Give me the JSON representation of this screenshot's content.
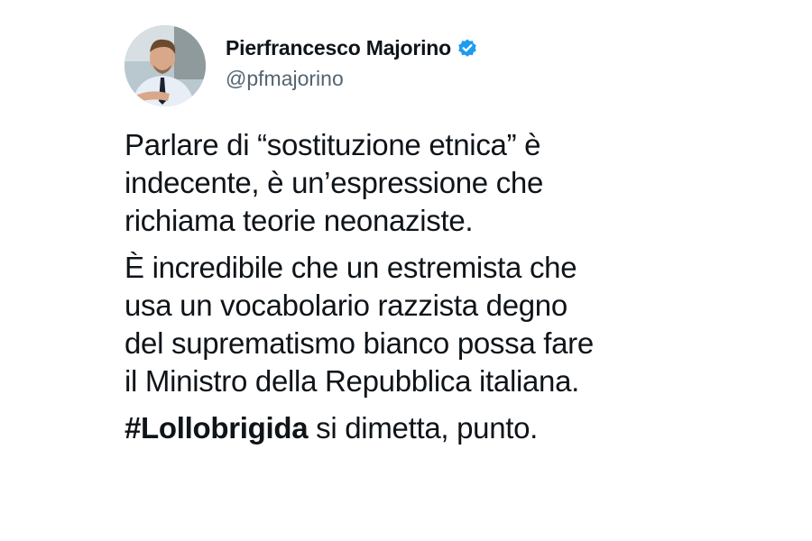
{
  "tweet": {
    "author": {
      "display_name": "Pierfrancesco Majorino",
      "handle": "@pfmajorino",
      "verified": true,
      "verified_color": "#1d9bf0",
      "avatar_icon": "profile-photo"
    },
    "paragraphs": [
      {
        "text": "Parlare di “sostituzione etnica” è\nindecente, è un’espressione che\nrichiama teorie neonaziste."
      },
      {
        "text": "È incredibile che un estremista che\nusa un vocabolario razzista degno\ndel suprematismo bianco possa fare\nil Ministro della Repubblica italiana."
      }
    ],
    "closing": {
      "hashtag": "#Lollobrigida",
      "rest": " si dimetta, punto."
    }
  }
}
